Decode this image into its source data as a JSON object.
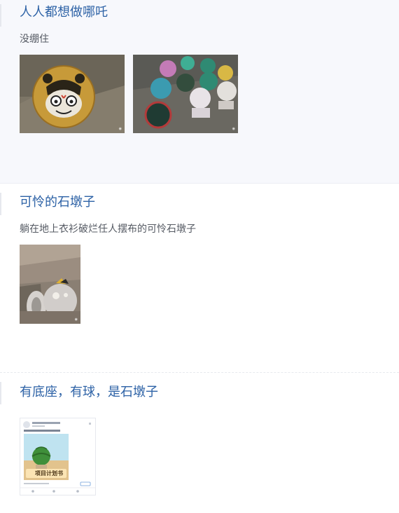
{
  "posts": [
    {
      "title": "人人都想做哪吒",
      "description": "没绷住",
      "images": [
        {
          "icon": "nezha-painted-stone-ball-photo"
        },
        {
          "icon": "painted-stone-balls-photo"
        }
      ]
    },
    {
      "title": "可怜的石墩子",
      "description": "躺在地上衣衫破烂任人摆布的可怜石墩子",
      "images": [
        {
          "icon": "fallen-stone-bollard-photo"
        }
      ]
    },
    {
      "title": "有底座，有球，是石墩子",
      "description": "",
      "images": [
        {
          "icon": "project-plan-card-thumbnail",
          "caption": "项目计划书"
        }
      ]
    }
  ]
}
